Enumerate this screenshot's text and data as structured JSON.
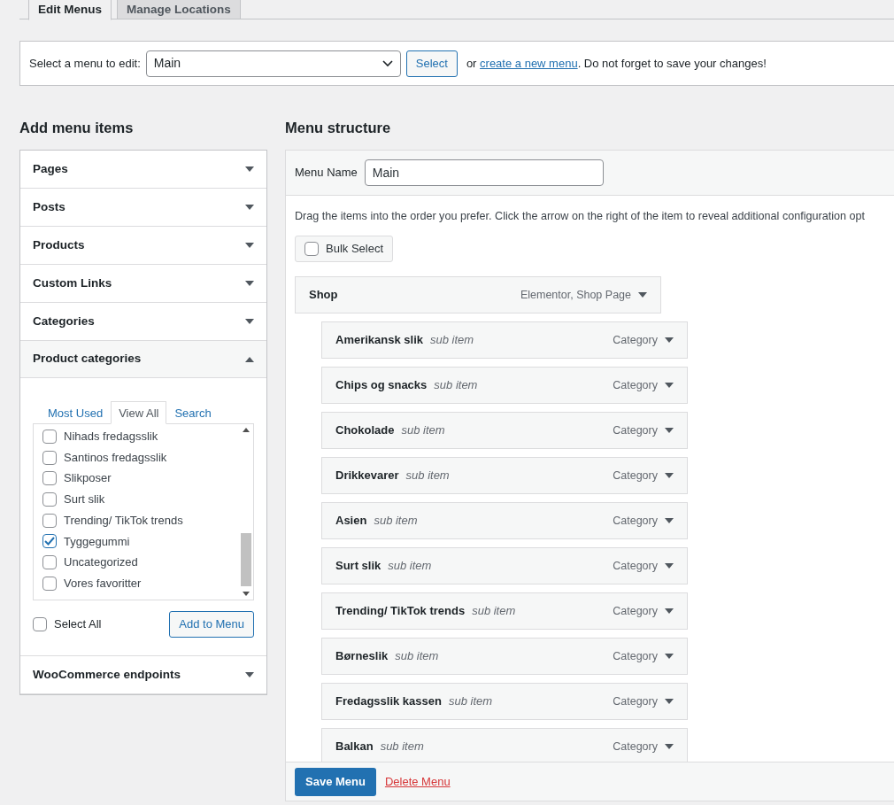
{
  "tabs": [
    {
      "label": "Edit Menus",
      "selected": true
    },
    {
      "label": "Manage Locations",
      "selected": false
    }
  ],
  "menu_select": {
    "label": "Select a menu to edit:",
    "value": "Main",
    "button": "Select",
    "text_before": "or",
    "link": "create a new menu",
    "text_after": ". Do not forget to save your changes!"
  },
  "add_items": {
    "title": "Add menu items",
    "sections": [
      {
        "label": "Pages",
        "expanded": false
      },
      {
        "label": "Posts",
        "expanded": false
      },
      {
        "label": "Products",
        "expanded": false
      },
      {
        "label": "Custom Links",
        "expanded": false
      },
      {
        "label": "Categories",
        "expanded": false
      },
      {
        "label": "Product categories",
        "expanded": true
      },
      {
        "label": "WooCommerce endpoints",
        "expanded": false
      }
    ],
    "subtabs": [
      {
        "label": "Most Used",
        "selected": false
      },
      {
        "label": "View All",
        "selected": true
      },
      {
        "label": "Search",
        "selected": false
      }
    ],
    "items": [
      {
        "label": "Nihads fredagsslik",
        "checked": false
      },
      {
        "label": "Santinos fredagsslik",
        "checked": false
      },
      {
        "label": "Slikposer",
        "checked": false
      },
      {
        "label": "Surt slik",
        "checked": false
      },
      {
        "label": "Trending/ TikTok trends",
        "checked": false
      },
      {
        "label": "Tyggegummi",
        "checked": true
      },
      {
        "label": "Uncategorized",
        "checked": false
      },
      {
        "label": "Vores favoritter",
        "checked": false
      }
    ],
    "select_all": {
      "label": "Select All",
      "checked": false
    },
    "add_button": "Add to Menu"
  },
  "structure": {
    "title": "Menu structure",
    "name_label": "Menu Name",
    "name_value": "Main",
    "instructions": "Drag the items into the order you prefer. Click the arrow on the right of the item to reveal additional configuration opt",
    "bulk_select": {
      "label": "Bulk Select",
      "checked": false
    },
    "items": [
      {
        "title": "Shop",
        "type": "Elementor, Shop Page",
        "children": [
          {
            "title": "Amerikansk slik",
            "note": "sub item",
            "type": "Category"
          },
          {
            "title": "Chips og snacks",
            "note": "sub item",
            "type": "Category"
          },
          {
            "title": "Chokolade",
            "note": "sub item",
            "type": "Category"
          },
          {
            "title": "Drikkevarer",
            "note": "sub item",
            "type": "Category"
          },
          {
            "title": "Asien",
            "note": "sub item",
            "type": "Category"
          },
          {
            "title": "Surt slik",
            "note": "sub item",
            "type": "Category"
          },
          {
            "title": "Trending/ TikTok trends",
            "note": "sub item",
            "type": "Category"
          },
          {
            "title": "Børneslik",
            "note": "sub item",
            "type": "Category"
          },
          {
            "title": "Fredagsslik kassen",
            "note": "sub item",
            "type": "Category"
          },
          {
            "title": "Balkan",
            "note": "sub item",
            "type": "Category"
          }
        ]
      }
    ],
    "save_button": "Save Menu",
    "delete_link": "Delete Menu"
  }
}
